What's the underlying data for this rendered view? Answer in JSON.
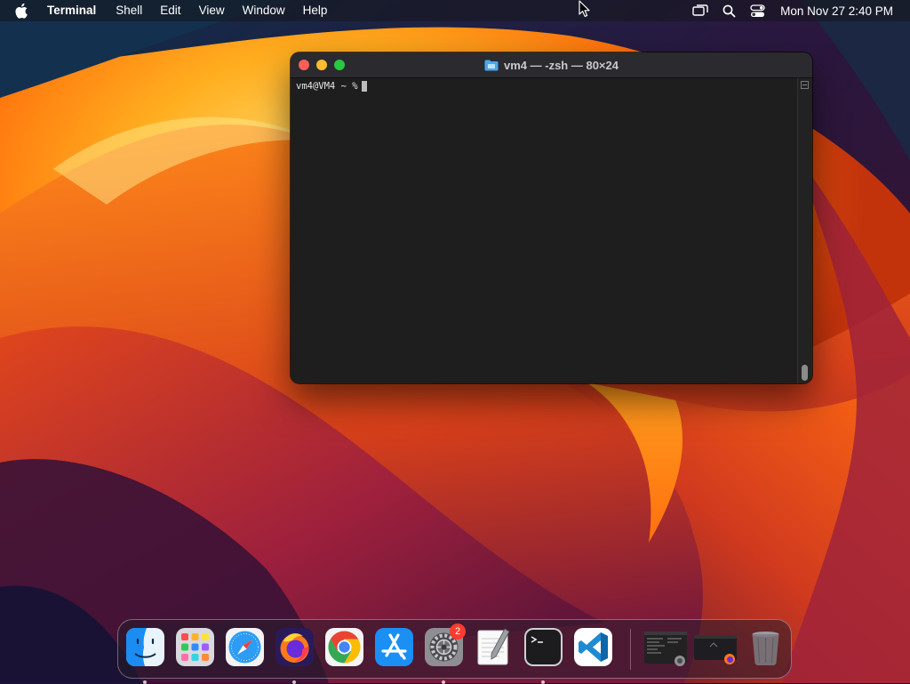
{
  "menubar": {
    "app_name": "Terminal",
    "menus": [
      "Shell",
      "Edit",
      "View",
      "Window",
      "Help"
    ],
    "clock": "Mon Nov 27  2:40 PM",
    "status_icons": [
      "screen-mirroring-icon",
      "search-icon",
      "control-center-icon"
    ]
  },
  "window": {
    "title": "vm4 — -zsh — 80×24",
    "prompt": "vm4@VM4 ~ %"
  },
  "dock": {
    "apps": [
      "Finder",
      "Launchpad",
      "Safari",
      "Firefox",
      "Google Chrome",
      "App Store",
      "System Settings",
      "TextEdit",
      "Terminal",
      "Visual Studio Code"
    ],
    "system_settings_badge": "2",
    "minimized_windows": [
      "Terminal window preview",
      "Firefox window preview"
    ],
    "trash": "Trash"
  },
  "colors": {
    "close": "#ff5f57",
    "minimize": "#febc2e",
    "maximize": "#28c840",
    "badge": "#ff3b30"
  }
}
